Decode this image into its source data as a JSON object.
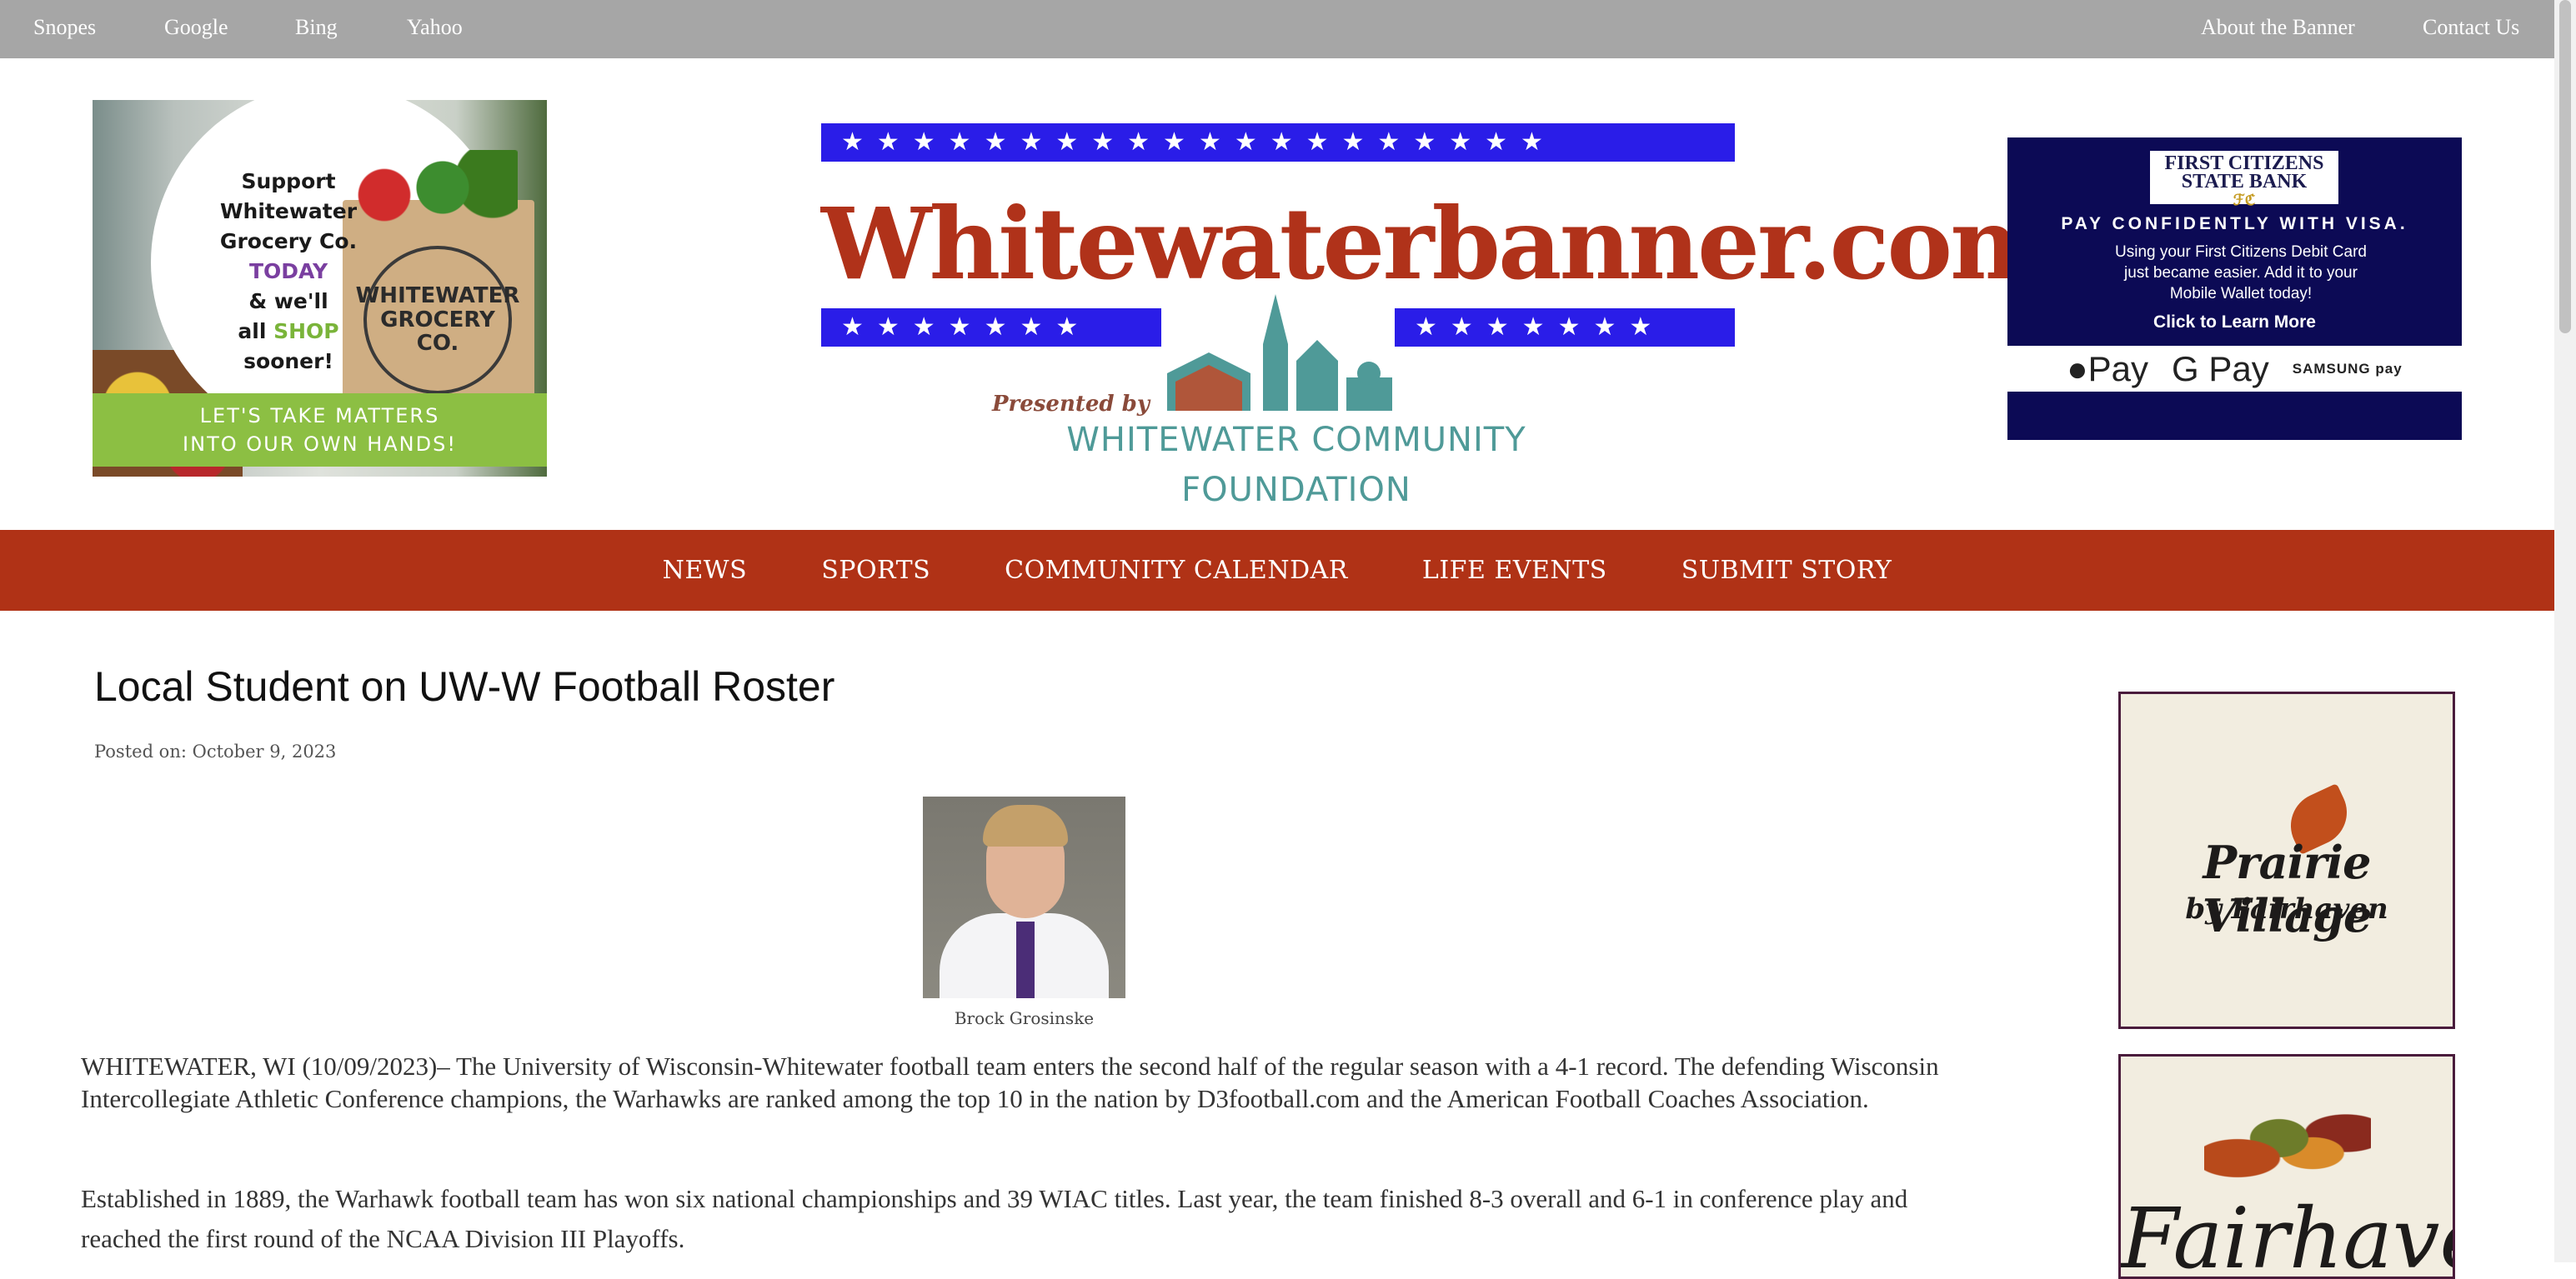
{
  "topbar": {
    "left_links": [
      "Snopes",
      "Google",
      "Bing",
      "Yahoo"
    ],
    "right_links": [
      "About the Banner",
      "Contact Us"
    ]
  },
  "ad_left": {
    "message_lines": [
      "Support",
      "Whitewater",
      "Grocery Co.",
      "TODAY",
      "& we'll",
      "all",
      "SHOP",
      "sooner!"
    ],
    "stamp_text": "WHITEWATER GROCERY CO.",
    "footer_lines": [
      "LET'S TAKE MATTERS",
      "INTO OUR OWN HANDS!"
    ]
  },
  "logo": {
    "title": "Whitewaterbanner.com",
    "presented": "Presented by",
    "foundation": "WHITEWATER COMMUNITY FOUNDATION"
  },
  "ad_right": {
    "bank_line1": "FIRST CITIZENS",
    "bank_line2": "STATE BANK",
    "headline": "PAY CONFIDENTLY WITH VISA.",
    "body_lines": [
      "Using your First Citizens Debit Card",
      "just became easier.  Add it to your",
      "Mobile Wallet today!"
    ],
    "cta": "Click to Learn More",
    "apple_pay": "Pay",
    "google_pay": "G Pay",
    "samsung_pay": "SAMSUNG pay"
  },
  "nav": {
    "items": [
      "NEWS",
      "SPORTS",
      "COMMUNITY CALENDAR",
      "LIFE EVENTS",
      "SUBMIT STORY"
    ]
  },
  "article": {
    "title": "Local Student on UW-W Football Roster",
    "posted": "Posted on: October 9, 2023",
    "photo_caption": "Brock Grosinske",
    "paragraphs": [
      "WHITEWATER, WI (10/09/2023)– The University of Wisconsin-Whitewater football team enters the second half of the regular season with a 4-1 record. The defending Wisconsin Intercollegiate Athletic Conference champions, the Warhawks are ranked among the top 10 in the nation by D3football.com and the American Football Coaches Association.",
      "Established in 1889, the Warhawk football team has won six national championships and 39 WIAC titles. Last year, the team finished 8-3 overall and 6-1 in conference play and reached the first round of the NCAA Division III Playoffs."
    ]
  },
  "sidebar": {
    "ad1_title": "Prairie Village",
    "ad1_sub": "by Fairhaven",
    "ad2_title": "Fairhaven"
  },
  "colors": {
    "topbar": "#a6a6a6",
    "nav": "#b03216",
    "star_bar": "#2a1de8",
    "logo_title": "#b0321a",
    "bank_navy": "#0c0a55"
  }
}
